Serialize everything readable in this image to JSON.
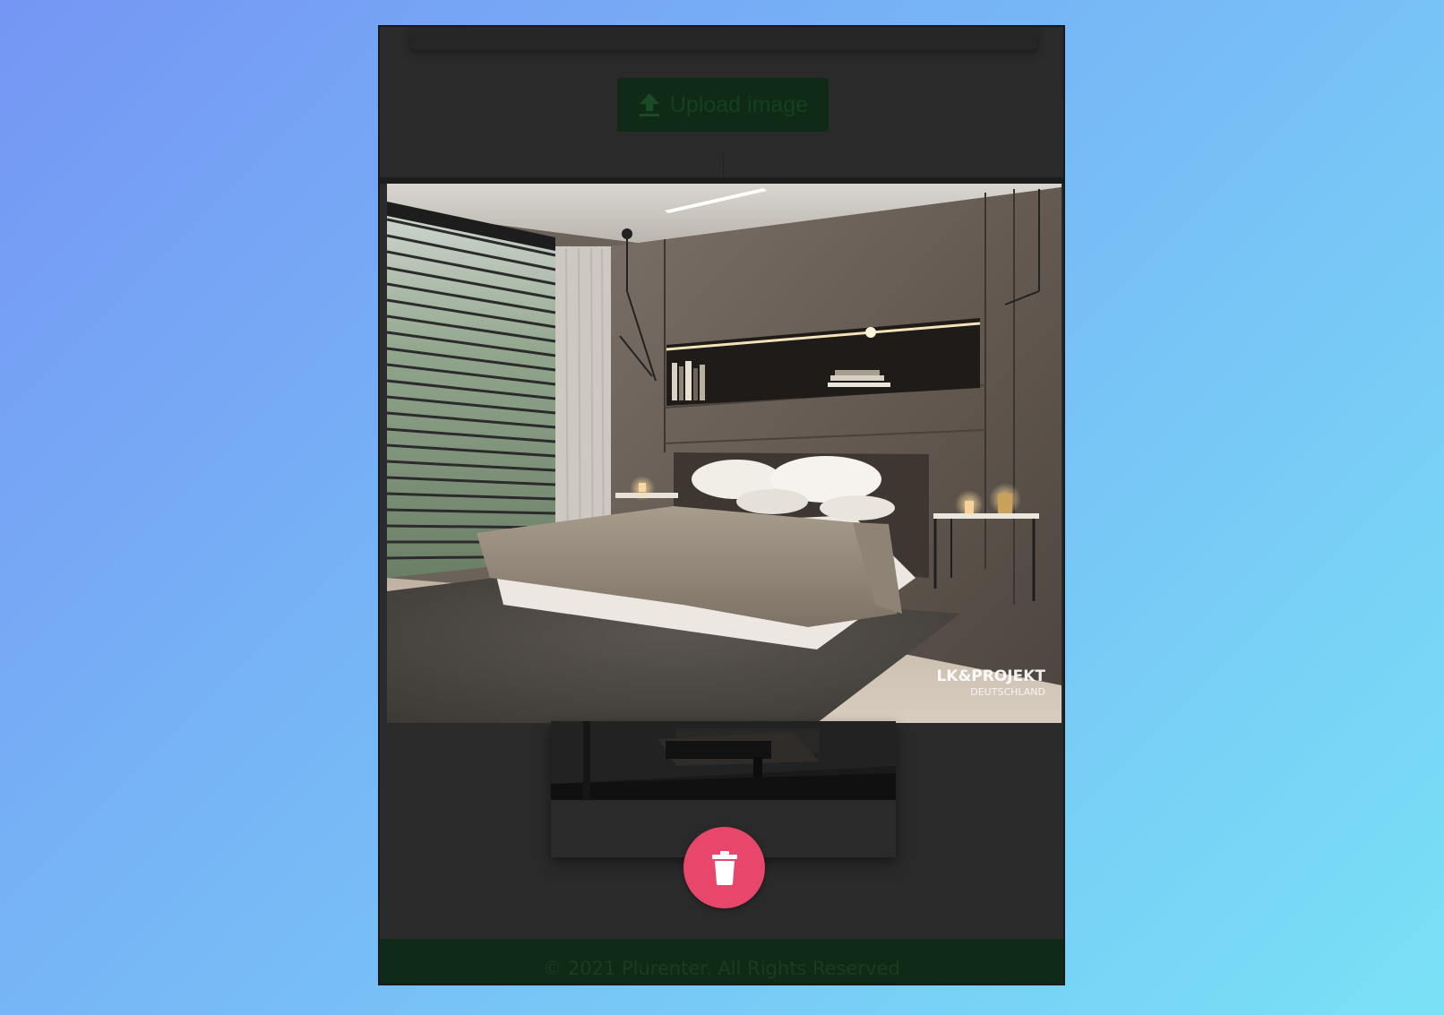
{
  "upload": {
    "label": "Upload image",
    "icon": "upload-icon"
  },
  "preview": {
    "watermark_brand": "LK&PROJEKT",
    "watermark_sub": "DEUTSCHLAND"
  },
  "actions": {
    "delete_icon": "trash-icon"
  },
  "footer": {
    "text": "© 2021 Plurenter. All Rights Reserved"
  },
  "colors": {
    "background_start": "#7596f4",
    "background_end": "#79e1f6",
    "frame": "#2a2a2a",
    "upload_button": "#0f2a16",
    "delete_button": "#e8466b",
    "footer": "#0f2a16"
  }
}
